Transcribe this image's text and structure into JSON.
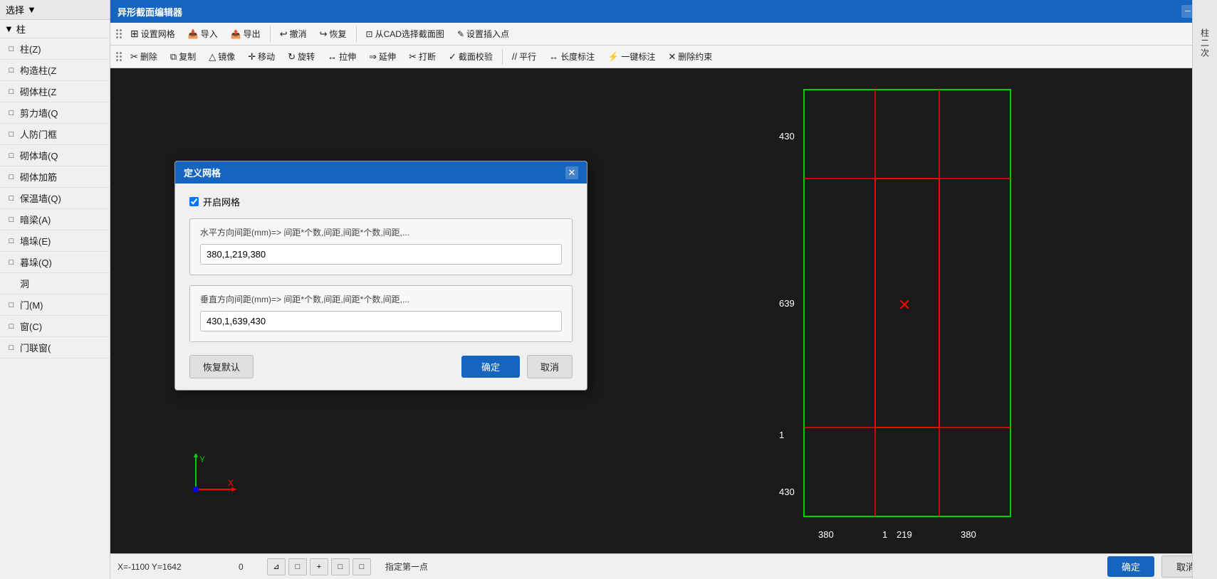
{
  "app": {
    "title": "异形截面编辑器",
    "window_controls": {
      "minimize": "─",
      "close": "✕"
    }
  },
  "toolbar1": {
    "items": [
      {
        "id": "set-grid",
        "label": "设置网格",
        "icon": "⊞"
      },
      {
        "id": "import",
        "label": "导入",
        "icon": "📥"
      },
      {
        "id": "export",
        "label": "导出",
        "icon": "📤"
      },
      {
        "id": "undo",
        "label": "撤消",
        "icon": "↩"
      },
      {
        "id": "redo",
        "label": "恢复",
        "icon": "↪"
      },
      {
        "id": "select-from-cad",
        "label": "从CAD选择截面图",
        "icon": "⊡"
      },
      {
        "id": "set-insert",
        "label": "设置插入点",
        "icon": "✎"
      }
    ]
  },
  "toolbar2": {
    "items": [
      {
        "id": "delete",
        "label": "删除",
        "icon": "✂"
      },
      {
        "id": "copy",
        "label": "复制",
        "icon": "⧉"
      },
      {
        "id": "mirror",
        "label": "镜像",
        "icon": "△"
      },
      {
        "id": "move",
        "label": "移动",
        "icon": "✛"
      },
      {
        "id": "rotate",
        "label": "旋转",
        "icon": "↻"
      },
      {
        "id": "stretch",
        "label": "拉伸",
        "icon": "↔"
      },
      {
        "id": "extend",
        "label": "延伸",
        "icon": "⇒"
      },
      {
        "id": "break",
        "label": "打断",
        "icon": "✂"
      },
      {
        "id": "section-check",
        "label": "截面校验",
        "icon": "✓"
      },
      {
        "id": "parallel",
        "label": "平行",
        "icon": "//"
      },
      {
        "id": "length-mark",
        "label": "长度标注",
        "icon": "↔"
      },
      {
        "id": "one-key-mark",
        "label": "一键标注",
        "icon": "⚡"
      },
      {
        "id": "del-constraint",
        "label": "删除约束",
        "icon": "✕"
      }
    ]
  },
  "sidebar": {
    "select_label": "选择",
    "select_option": "选择",
    "column_label": "柱",
    "items": [
      {
        "id": "zhu-z",
        "label": "柱(Z)",
        "icon": "□"
      },
      {
        "id": "gouzao-z",
        "label": "构造柱(Z",
        "icon": "□"
      },
      {
        "id": "poti-z",
        "label": "砌体柱(Z",
        "icon": "□"
      },
      {
        "id": "jianli-q",
        "label": "剪力墙(Q",
        "icon": "□"
      },
      {
        "id": "renfang-m",
        "label": "人防门框",
        "icon": "□"
      },
      {
        "id": "poti-q",
        "label": "砌体墙(Q",
        "icon": "□"
      },
      {
        "id": "poti-jia",
        "label": "砌体加筋",
        "icon": "□"
      },
      {
        "id": "baowenq",
        "label": "保温墙(Q)",
        "icon": "□"
      },
      {
        "id": "anliang-a",
        "label": "暗梁(A)",
        "icon": "□"
      },
      {
        "id": "qiangcuo-e",
        "label": "墙垛(E)",
        "icon": "□"
      },
      {
        "id": "mucuo-q",
        "label": "暮垛(Q)",
        "icon": "□"
      },
      {
        "id": "dong",
        "label": "洞",
        "icon": ""
      },
      {
        "id": "men-m",
        "label": "门(M)",
        "icon": "□"
      },
      {
        "id": "chuang-c",
        "label": "窗(C)",
        "icon": "□"
      },
      {
        "id": "menlianchuang",
        "label": "门联窗(",
        "icon": "□"
      }
    ]
  },
  "dialog": {
    "title": "定义网格",
    "close_btn": "✕",
    "enable_grid_label": "开启网格",
    "enable_grid_checked": true,
    "horizontal_group_label": "水平方向间距(mm)=> 间距*个数,间距,间距*个数,间距,...",
    "horizontal_value": "380,1,219,380",
    "vertical_group_label": "垂直方向间距(mm)=> 间距*个数,间距,间距*个数,间距,...",
    "vertical_value": "430,1,639,430",
    "restore_btn": "恢复默认",
    "ok_btn": "确定",
    "cancel_btn": "取消"
  },
  "canvas": {
    "coord_text": "X=-1100  Y=1642",
    "zero_text": "0",
    "hint_text": "指定第一点",
    "confirm_btn": "确定",
    "cancel_btn": "取消",
    "grid_labels": {
      "top": "430",
      "mid_left": "639",
      "mid_left2": "1",
      "bottom": "430",
      "bottom_x1": "380",
      "bottom_x2": "1",
      "bottom_x3": "219",
      "bottom_x4": "380"
    }
  },
  "right_panel": {
    "label": "柱二次"
  },
  "status_tools": [
    {
      "id": "snap1",
      "icon": "⊿"
    },
    {
      "id": "snap2",
      "icon": "□"
    },
    {
      "id": "snap3",
      "icon": "+"
    },
    {
      "id": "snap4",
      "icon": "□"
    },
    {
      "id": "snap5",
      "icon": "□"
    }
  ]
}
